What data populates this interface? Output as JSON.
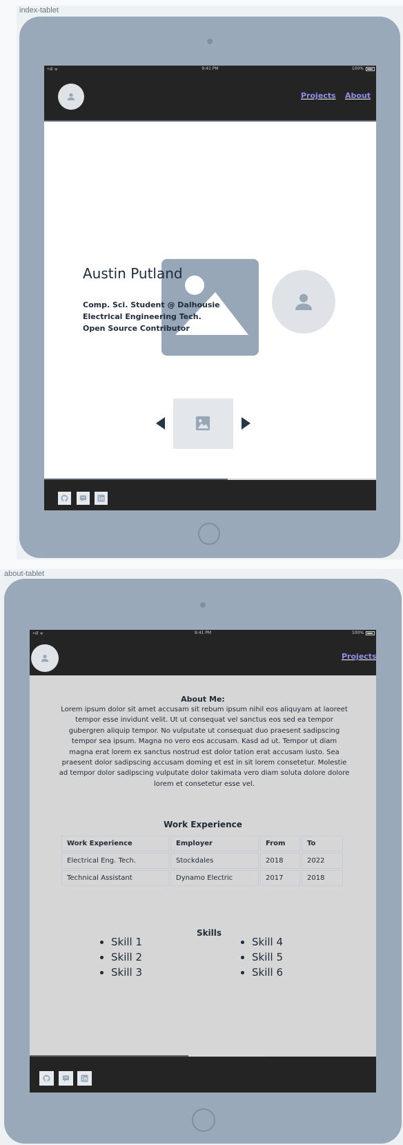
{
  "frames": [
    {
      "label": "index-tablet",
      "status": {
        "signal": "•ıll ᯤ",
        "time": "9:41 PM",
        "battery": "100%"
      },
      "nav": {
        "links": [
          "Projects",
          "About"
        ]
      },
      "hero": {
        "name": "Austin Putland",
        "lines": [
          "Comp. Sci. Student @ Dalhousie",
          "Electrical Engineering Tech.",
          "Open Source Contributor"
        ]
      }
    },
    {
      "label": "about-tablet",
      "status": {
        "signal": "•ıll ᯤ",
        "time": "9:41 PM",
        "battery": "100%"
      },
      "nav": {
        "links": [
          "Projects"
        ]
      },
      "about": {
        "title": "About Me:",
        "body": "Lorem ipsum dolor sit amet accusam sit rebum ipsum nihil eos aliquyam at laoreet tempor esse invidunt velit. Ut ut consequat vel sanctus eos sed ea tempor gubergren aliquip tempor. No vulputate ut consequat duo praesent sadipscing tempor sea ipsum. Magna no vero eos accusam. Kasd ad ut. Tempor ut diam magna erat lorem ex sanctus nostrud est dolor tation erat accusam iusto. Sea praesent dolor sadipscing accusam doming et est in sit lorem consetetur. Molestie ad tempor dolor sadipscing vulputate dolor takimata vero diam soluta dolore dolore lorem et consetetur esse vel."
      },
      "work": {
        "title": "Work Experience",
        "headers": [
          "Work Experience",
          "Employer",
          "From",
          "To"
        ],
        "rows": [
          [
            "Electrical Eng. Tech.",
            "Stockdales",
            "2018",
            "2022"
          ],
          [
            "Technical Assistant",
            "Dynamo Electric",
            "2017",
            "2018"
          ]
        ]
      },
      "skills": {
        "title": "Skills",
        "left": [
          "Skill 1",
          "Skill 2",
          "Skill 3"
        ],
        "right": [
          "Skill 4",
          "Skill 5",
          "Skill 6"
        ]
      }
    }
  ],
  "icons": {
    "avatar": "person-icon",
    "image": "image-placeholder-icon",
    "social": [
      "github-icon",
      "chat-icon",
      "linkedin-icon"
    ],
    "carousel": [
      "arrow-left-icon",
      "arrow-right-icon"
    ]
  },
  "colors": {
    "tablet_body": "#9aa9b9",
    "dark_bar": "#242424",
    "nav_link": "#8f8ff0",
    "about_bg": "#d6d6d6",
    "image_placeholder": "#97a7b8"
  }
}
